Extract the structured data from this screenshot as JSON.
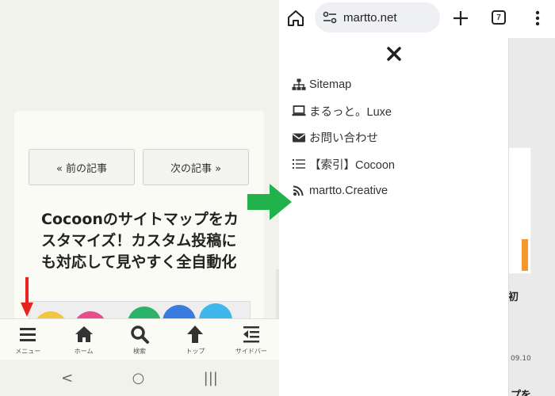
{
  "left_screen": {
    "post_nav": {
      "prev_label": "« 前の記事",
      "next_label": "次の記事 »"
    },
    "post_title": "Cocoonのサイトマップをカスタマイズ！カスタム投稿にも対応して見やすく全自動化",
    "footer_menu": [
      {
        "label": "メニュー",
        "icon": "hamburger-icon"
      },
      {
        "label": "ホーム",
        "icon": "home-icon"
      },
      {
        "label": "検索",
        "icon": "search-icon"
      },
      {
        "label": "トップ",
        "icon": "arrow-up-icon"
      },
      {
        "label": "サイドバー",
        "icon": "sidebar-icon"
      }
    ],
    "system_nav": {
      "back": "<",
      "home": "○",
      "recents": "|||"
    }
  },
  "right_screen": {
    "browser": {
      "url": "martto.net",
      "tab_count": "7"
    },
    "drawer_menu": [
      {
        "label": "Sitemap",
        "icon": "sitemap-icon"
      },
      {
        "label": "まるっと。Luxe",
        "icon": "laptop-icon"
      },
      {
        "label": "お問い合わせ",
        "icon": "envelope-icon"
      },
      {
        "label": "【索引】Cocoon",
        "icon": "list-icon"
      },
      {
        "label": "martto.Creative",
        "icon": "rss-icon"
      }
    ],
    "background_fragments": {
      "title_tail": "！初",
      "date_tail": "09.10",
      "title_tail_2": "プを"
    }
  },
  "colors": {
    "red_arrow": "#e8231e",
    "green_arrow": "#22b24c",
    "accent_orange": "#f59a2a"
  }
}
